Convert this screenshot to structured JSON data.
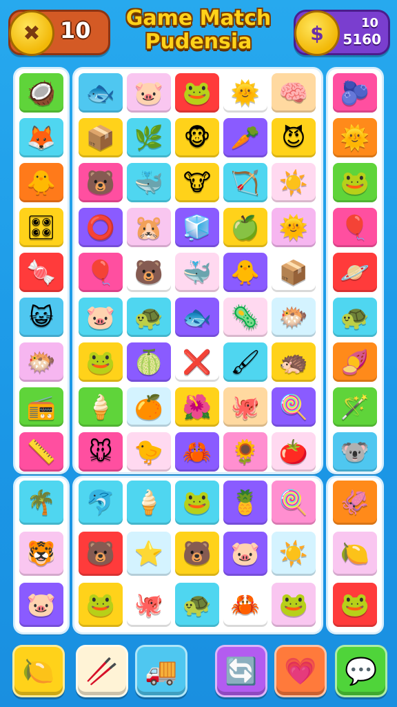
{
  "header": {
    "moves_value": "10",
    "moves_icon": "crossed-sticks-icon",
    "title_line1": "Game Match",
    "title_line2": "Pudensia",
    "score_icon": "dollar-coin-icon",
    "score_level": "10",
    "score_value": "5160"
  },
  "boards": {
    "left_top": [
      {
        "icon": "🥥",
        "bg": "#5fd43a"
      },
      {
        "icon": "🦊",
        "bg": "#4fd6f0"
      },
      {
        "icon": "🐥",
        "bg": "#ff7a1a"
      },
      {
        "icon": "🎛",
        "bg": "#ffd21a"
      },
      {
        "icon": "🍬",
        "bg": "#ff3b3b"
      },
      {
        "icon": "😺",
        "bg": "#4fc7f0"
      },
      {
        "icon": "🐡",
        "bg": "#f6b6f0"
      },
      {
        "icon": "📻",
        "bg": "#5fd43a"
      },
      {
        "icon": "📏",
        "bg": "#ff4fa0"
      }
    ],
    "center_top": [
      {
        "icon": "🐟",
        "bg": "#4fc7f0"
      },
      {
        "icon": "🐷",
        "bg": "#f9c6f0"
      },
      {
        "icon": "🐸",
        "bg": "#ff3b3b"
      },
      {
        "icon": "🌞",
        "bg": "#ffffff"
      },
      {
        "icon": "🧠",
        "bg": "#ffd9a0"
      },
      {
        "icon": "📦",
        "bg": "#ffd21a"
      },
      {
        "icon": "🌿",
        "bg": "#4fd6f0"
      },
      {
        "icon": "🐵",
        "bg": "#ffd21a"
      },
      {
        "icon": "🥕",
        "bg": "#8a5bff"
      },
      {
        "icon": "😈",
        "bg": "#ffd21a"
      },
      {
        "icon": "🐻",
        "bg": "#ff4fa0"
      },
      {
        "icon": "🐳",
        "bg": "#4fd6f0"
      },
      {
        "icon": "🐮",
        "bg": "#ffd21a"
      },
      {
        "icon": "🏹",
        "bg": "#4fd6f0"
      },
      {
        "icon": "☀️",
        "bg": "#ffd9f0"
      },
      {
        "icon": "⭕",
        "bg": "#8a5bff"
      },
      {
        "icon": "🐹",
        "bg": "#f9c6f0"
      },
      {
        "icon": "🧊",
        "bg": "#8a5bff"
      },
      {
        "icon": "🍏",
        "bg": "#ffd21a"
      },
      {
        "icon": "🌞",
        "bg": "#f6b6f0"
      },
      {
        "icon": "🎈",
        "bg": "#ff4fa0"
      },
      {
        "icon": "🐻",
        "bg": "#ffffff"
      },
      {
        "icon": "🐳",
        "bg": "#ffd9f0"
      },
      {
        "icon": "🐥",
        "bg": "#8a5bff"
      },
      {
        "icon": "📦",
        "bg": "#ffffff"
      },
      {
        "icon": "🐷",
        "bg": "#4fd6f0"
      },
      {
        "icon": "🐢",
        "bg": "#4fd6f0"
      },
      {
        "icon": "🐟",
        "bg": "#8a5bff"
      },
      {
        "icon": "🦠",
        "bg": "#ffd9f0"
      },
      {
        "icon": "🐡",
        "bg": "#d4f3ff"
      },
      {
        "icon": "🐸",
        "bg": "#ffd21a"
      },
      {
        "icon": "🍈",
        "bg": "#8a5bff"
      },
      {
        "icon": "❌",
        "bg": "#ffffff"
      },
      {
        "icon": "🖌",
        "bg": "#4fd6f0"
      },
      {
        "icon": "🦔",
        "bg": "#ffd21a"
      },
      {
        "icon": "🍦",
        "bg": "#5fd43a"
      },
      {
        "icon": "🍊",
        "bg": "#d4f3ff"
      },
      {
        "icon": "🌺",
        "bg": "#ffd21a"
      },
      {
        "icon": "🐙",
        "bg": "#ffd9a0"
      },
      {
        "icon": "🍭",
        "bg": "#8a5bff"
      },
      {
        "icon": "🐭",
        "bg": "#ff4fa0"
      },
      {
        "icon": "🐤",
        "bg": "#ffd9f0"
      },
      {
        "icon": "🦀",
        "bg": "#8a5bff"
      },
      {
        "icon": "🌻",
        "bg": "#ff8fd0"
      },
      {
        "icon": "🍅",
        "bg": "#ffd9f0"
      }
    ],
    "right_top": [
      {
        "icon": "🫐",
        "bg": "#ff4fa0"
      },
      {
        "icon": "🌞",
        "bg": "#ff8a1a"
      },
      {
        "icon": "🐸",
        "bg": "#5fd43a"
      },
      {
        "icon": "🎈",
        "bg": "#ff4fa0"
      },
      {
        "icon": "🪐",
        "bg": "#ff3b3b"
      },
      {
        "icon": "🐢",
        "bg": "#4fd6f0"
      },
      {
        "icon": "🍠",
        "bg": "#ff8a1a"
      },
      {
        "icon": "🪄",
        "bg": "#5fd43a"
      },
      {
        "icon": "🐨",
        "bg": "#4fc7f0"
      }
    ],
    "left_bottom": [
      {
        "icon": "🌴",
        "bg": "#4fd6f0"
      },
      {
        "icon": "🐯",
        "bg": "#f9c6f0"
      },
      {
        "icon": "🐷",
        "bg": "#8a5bff"
      }
    ],
    "center_bottom": [
      {
        "icon": "🐬",
        "bg": "#4fd6f0"
      },
      {
        "icon": "🍦",
        "bg": "#4fd6f0"
      },
      {
        "icon": "🐸",
        "bg": "#4fd6f0"
      },
      {
        "icon": "🍍",
        "bg": "#8a5bff"
      },
      {
        "icon": "🍭",
        "bg": "#ff8fd0"
      },
      {
        "icon": "🐻",
        "bg": "#ff3b3b"
      },
      {
        "icon": "⭐",
        "bg": "#d4f3ff"
      },
      {
        "icon": "🐻",
        "bg": "#ffd21a"
      },
      {
        "icon": "🐷",
        "bg": "#8a5bff"
      },
      {
        "icon": "☀️",
        "bg": "#d4f3ff"
      },
      {
        "icon": "🐸",
        "bg": "#ffd21a"
      },
      {
        "icon": "🐙",
        "bg": "#ffffff"
      },
      {
        "icon": "🐢",
        "bg": "#4fd6f0"
      },
      {
        "icon": "🦀",
        "bg": "#ffffff"
      },
      {
        "icon": "🐸",
        "bg": "#f9c6f0"
      }
    ],
    "right_bottom": [
      {
        "icon": "🦑",
        "bg": "#ff8a1a"
      },
      {
        "icon": "🍋",
        "bg": "#f9c6f0"
      },
      {
        "icon": "🐸",
        "bg": "#ff3b3b"
      }
    ]
  },
  "bottom_bar": [
    {
      "name": "lemon-button",
      "icon": "🍋",
      "bg": "#ffd21a"
    },
    {
      "name": "crossed-sticks-button",
      "icon": "🥢",
      "bg": "#fff3d6"
    },
    {
      "name": "truck-button",
      "icon": "🚚",
      "bg": "#4fc7f0"
    },
    {
      "name": "refresh-button",
      "icon": "🔄",
      "bg": "#b35cf0"
    },
    {
      "name": "heart-button",
      "icon": "💗",
      "bg": "#ff7a3b"
    },
    {
      "name": "chat-button",
      "icon": "💬",
      "bg": "#4fd43a"
    }
  ]
}
